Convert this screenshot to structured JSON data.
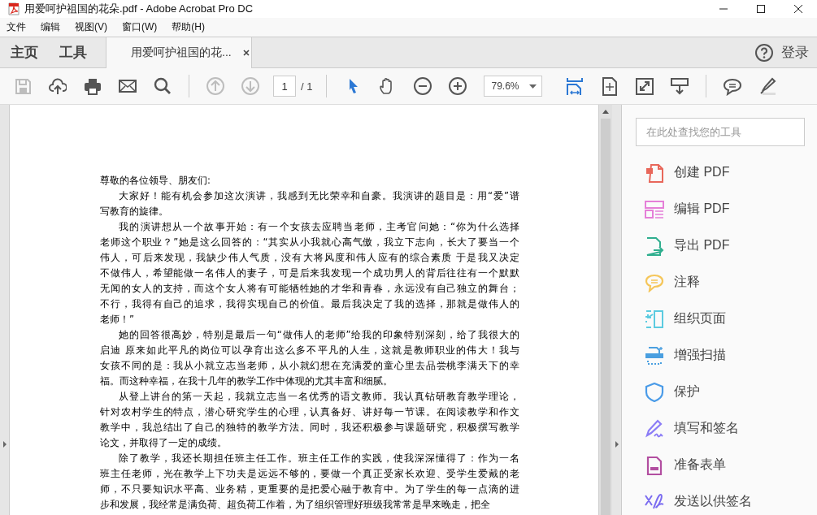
{
  "window": {
    "title": "用爱呵护祖国的花朵.pdf - Adobe Acrobat Pro DC"
  },
  "menu": {
    "items": [
      "文件",
      "编辑",
      "视图(V)",
      "窗口(W)",
      "帮助(H)"
    ]
  },
  "tabs": [
    {
      "label": "主页",
      "selected": false,
      "kind": "nav"
    },
    {
      "label": "工具",
      "selected": false,
      "kind": "nav"
    },
    {
      "label": "用爱呵护祖国的花...",
      "selected": true,
      "kind": "document"
    }
  ],
  "account": {
    "label": "登录"
  },
  "toolbar": {
    "items": [
      {
        "kind": "save",
        "disabled": true,
        "selected": false
      },
      {
        "kind": "upload",
        "disabled": false,
        "selected": false
      },
      {
        "kind": "print",
        "disabled": false,
        "selected": false
      },
      {
        "kind": "mail",
        "disabled": false,
        "selected": false
      },
      {
        "kind": "search",
        "disabled": false,
        "selected": false
      },
      {
        "kind": "separator"
      },
      {
        "kind": "prev",
        "disabled": true,
        "selected": false
      },
      {
        "kind": "next",
        "disabled": true,
        "selected": false
      },
      {
        "kind": "page-field",
        "value": "1",
        "total": "/ 1"
      },
      {
        "kind": "separator"
      },
      {
        "kind": "select",
        "disabled": false,
        "selected": true
      },
      {
        "kind": "hand",
        "disabled": false,
        "selected": false
      },
      {
        "kind": "zoom-out",
        "disabled": false,
        "selected": false
      },
      {
        "kind": "zoom-in",
        "disabled": false,
        "selected": false
      },
      {
        "kind": "zoom-field",
        "value": "79.6%"
      },
      {
        "kind": "fit-width",
        "disabled": false,
        "selected": true
      },
      {
        "kind": "fit-page",
        "disabled": false,
        "selected": false
      },
      {
        "kind": "fullscreen",
        "disabled": false,
        "selected": false
      },
      {
        "kind": "read-mode",
        "disabled": false,
        "selected": false
      },
      {
        "kind": "separator"
      },
      {
        "kind": "comment",
        "disabled": false,
        "selected": false
      },
      {
        "kind": "highlight",
        "disabled": false,
        "selected": false
      }
    ]
  },
  "document": {
    "paragraphs": [
      {
        "indent": false,
        "lines": [
          "尊敬的各位领导、朋友们:"
        ]
      },
      {
        "indent": true,
        "lines": [
          "大家好！能有机会参加这次演讲，我感到无比荣幸和自豪。我演讲的题目是：用“爱”谱",
          "写教育的旋律。"
        ]
      },
      {
        "indent": true,
        "lines": [
          "我的演讲想从一个故事开始：有一个女孩去应聘当老师，主考官问她：“你为什么选择",
          "老师这个职业？”她是这么回答的：“其实从小我就心高气傲，我立下志向，长大了要当一个",
          "伟人，可后来发现，我缺少伟人气质，没有大将风度和伟人应有的综合素质 于是我又决定",
          "不做伟人，希望能做一名伟人的妻子，可是后来我发现一个成功男人的背后往往有一个默默",
          "无闻的女人的支持，而这个女人将有可能牺牲她的才华和青春，永远没有自己独立的舞台；",
          "不行，我得有自己的追求，我得实现自己的价值。最后我决定了我的选择，那就是做伟人的",
          "老师！”"
        ]
      },
      {
        "indent": true,
        "lines": [
          "她的回答很高妙，特别是最后一句“做伟人的老师”给我的印象特别深刻，给了我很大的",
          "启迪 原来如此平凡的岗位可以孕育出这么多不平凡的人生，这就是教师职业的伟大！我与",
          "女孩不同的是：我从小就立志当老师，从小就幻想在充满爱的童心里去品尝桃李满天下的幸",
          "福。而这种幸福，在我十几年的教学工作中体现的尤其丰富和细腻。"
        ]
      },
      {
        "indent": true,
        "lines": [
          "从登上讲台的第一天起，我就立志当一名优秀的语文教师。我认真钻研教育教学理论，",
          "针对农村学生的特点，潜心研究学生的心理，认真备好、讲好每一节课。在阅读教学和作文",
          "教学中，我总结出了自己的独特的教学方法。同时，我还积极参与课题研究，积极撰写教学",
          "论文，并取得了一定的成绩。"
        ]
      },
      {
        "indent": true,
        "lines": [
          "除了教学，我还长期担任班主任工作。班主任工作的实践，使我深深懂得了：作为一名",
          "班主任老师，光在教学上下功夫是远远不够的，要做一个真正受家长欢迎、受学生爱戴的老",
          "师，不只要知识水平高、业务精，更重要的是把爱心融于教育中。为了学生的每一点滴的进",
          "步和发展，我经常是满负荷、超负荷工作着，为了组织管理好班级我常常是早来晚走，把全"
        ]
      }
    ]
  },
  "tools_panel": {
    "search": {
      "placeholder": "在此处查找您的工具"
    },
    "items": [
      {
        "label": "创建 PDF",
        "kind": "create",
        "color": "#e8675a"
      },
      {
        "label": "编辑 PDF",
        "kind": "edit",
        "color": "#e57fd8"
      },
      {
        "label": "导出 PDF",
        "kind": "export",
        "color": "#2fae8e"
      },
      {
        "label": "注释",
        "kind": "comment",
        "color": "#f5c65a"
      },
      {
        "label": "组织页面",
        "kind": "organize",
        "color": "#5ccbe0"
      },
      {
        "label": "增强扫描",
        "kind": "scan",
        "color": "#4a9fe0"
      },
      {
        "label": "保护",
        "kind": "protect",
        "color": "#4a9be8"
      },
      {
        "label": "填写和签名",
        "kind": "sign",
        "color": "#8b7cf6"
      },
      {
        "label": "准备表单",
        "kind": "form",
        "color": "#b24ea0"
      },
      {
        "label": "发送以供签名",
        "kind": "send",
        "color": "#7b6cf0"
      }
    ]
  }
}
